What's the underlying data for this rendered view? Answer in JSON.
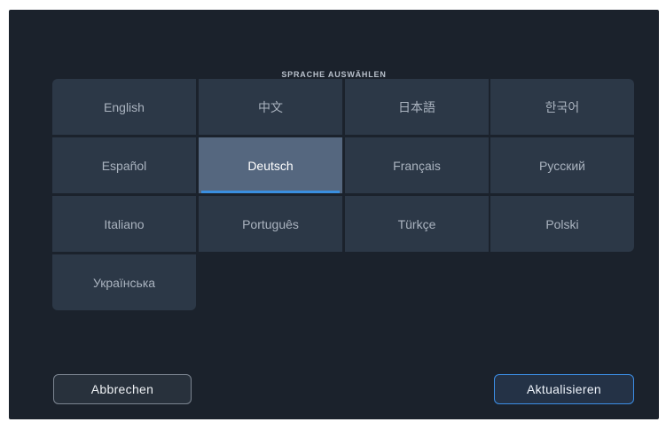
{
  "dialog": {
    "title": "SPRACHE AUSWÄHLEN",
    "selected_language": "Deutsch",
    "colors": {
      "background": "#1b222c",
      "tile": "#2c3847",
      "tile_selected": "#55677f",
      "accent": "#3a8fe0"
    }
  },
  "languages": [
    {
      "label": "English"
    },
    {
      "label": "中文"
    },
    {
      "label": "日本語"
    },
    {
      "label": "한국어"
    },
    {
      "label": "Español"
    },
    {
      "label": "Deutsch"
    },
    {
      "label": "Français"
    },
    {
      "label": "Русский"
    },
    {
      "label": "Italiano"
    },
    {
      "label": "Português"
    },
    {
      "label": "Türkçe"
    },
    {
      "label": "Polski"
    },
    {
      "label": "Українська"
    }
  ],
  "buttons": {
    "cancel_label": "Abbrechen",
    "update_label": "Aktualisieren"
  }
}
